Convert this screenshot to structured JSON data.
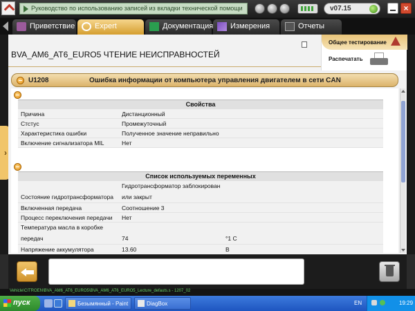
{
  "topbar": {
    "marquee": "Руководство по использованию записей из вкладки технической помощи",
    "version": "v07.15"
  },
  "tabs": [
    {
      "label": "Приветствие"
    },
    {
      "label": "Expert"
    },
    {
      "label": "Документация"
    },
    {
      "label": "Измерения"
    },
    {
      "label": "Отчеты"
    }
  ],
  "page": {
    "title": "BVA_AM6_AT6_EURO5  ЧТЕНИЕ НЕИСПРАВНОСТЕЙ",
    "card_test": "Общее тестирование",
    "card_print": "Распечатать"
  },
  "fault": {
    "code": "U1208",
    "description": "Ошибка информации от компьютера управления двигателем в сети CAN"
  },
  "properties": {
    "header": "Свойства",
    "rows": [
      {
        "name": "Причина",
        "value": "Дистанционный"
      },
      {
        "name": "Стстус",
        "value": "Промежуточный"
      },
      {
        "name": "Характеристика ошибки",
        "value": "Полученное значение неправильно"
      },
      {
        "name": "Включение сигнализатора MIL",
        "value": "Нет"
      }
    ]
  },
  "variables": {
    "header": "Список используемых переменных",
    "rows": [
      {
        "name": "Состояние гидротрансформатора",
        "value_line1": "Гидротрансформатор заблокирован",
        "value_line2": "или закрыт",
        "unit": ""
      },
      {
        "name": "Включенная передача",
        "value": "Соотношение 3",
        "unit": ""
      },
      {
        "name": "Процесс переключения передачи",
        "value": "Нет",
        "unit": ""
      },
      {
        "name_line1": "Температура масла в коробке",
        "name_line2": "передач",
        "value": "74",
        "unit": "°1 C"
      },
      {
        "name": "Напряжение аккумулятора",
        "value": "13.60",
        "unit": "В"
      }
    ]
  },
  "status_path": "Vehicle\\CITROEN\\BVA_AM6_AT6_EURO5\\BVA_AM6_AT6_EURO5_Lecture_defauts.s - 1207_02",
  "taskbar": {
    "start": "пуск",
    "task1": "Безымянный - Paint",
    "task2": "DiagBox",
    "lang": "EN",
    "clock": "19:29"
  }
}
